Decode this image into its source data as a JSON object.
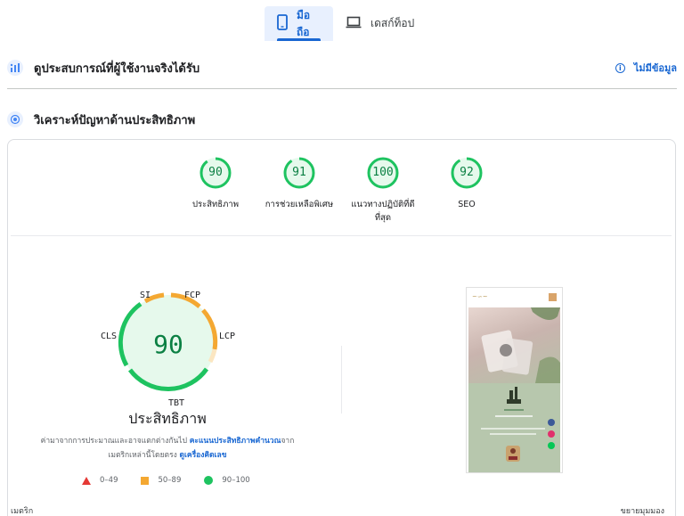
{
  "tabs": [
    {
      "label": "มือถือ",
      "icon": "phone-icon",
      "active": true
    },
    {
      "label": "เดสก์ท็อป",
      "icon": "laptop-icon",
      "active": false
    }
  ],
  "field_section": {
    "title": "ดูประสบการณ์ที่ผู้ใช้งานจริงได้รับ",
    "status": "ไม่มีข้อมูล"
  },
  "diagnose_section": {
    "title": "วิเคราะห์ปัญหาด้านประสิทธิภาพ"
  },
  "scores": [
    {
      "value": "90",
      "label": "ประสิทธิภาพ",
      "fraction": 0.9
    },
    {
      "value": "91",
      "label": "การช่วยเหลือพิเศษ",
      "fraction": 0.91
    },
    {
      "value": "100",
      "label": "แนวทางปฏิบัติที่ดีที่สุด",
      "fraction": 1.0
    },
    {
      "value": "92",
      "label": "SEO",
      "fraction": 0.92
    }
  ],
  "performance": {
    "score": "90",
    "title": "ประสิทธิภาพ",
    "metrics": [
      "SI",
      "FCP",
      "LCP",
      "TBT",
      "CLS"
    ],
    "desc_prefix": "ค่ามาจากการประมาณและอาจแตกต่างกันไป ",
    "desc_link1": "คะแนนประสิทธิภาพคำนวณ",
    "desc_mid": "จากเมตริกเหล่านี้โดยตรง ",
    "desc_link2": "ดูเครื่องคิดเลข"
  },
  "legend": [
    {
      "label": "0–49",
      "color": "#e53935"
    },
    {
      "label": "50–89",
      "color": "#f4a832"
    },
    {
      "label": "90–100",
      "color": "#1ec360"
    }
  ],
  "footer": {
    "left": "เมตริก",
    "right": "ขยายมุมมอง"
  },
  "colors": {
    "accent": "#1967d2",
    "good": "#1ec360",
    "average": "#f4a832",
    "poor": "#e53935"
  }
}
